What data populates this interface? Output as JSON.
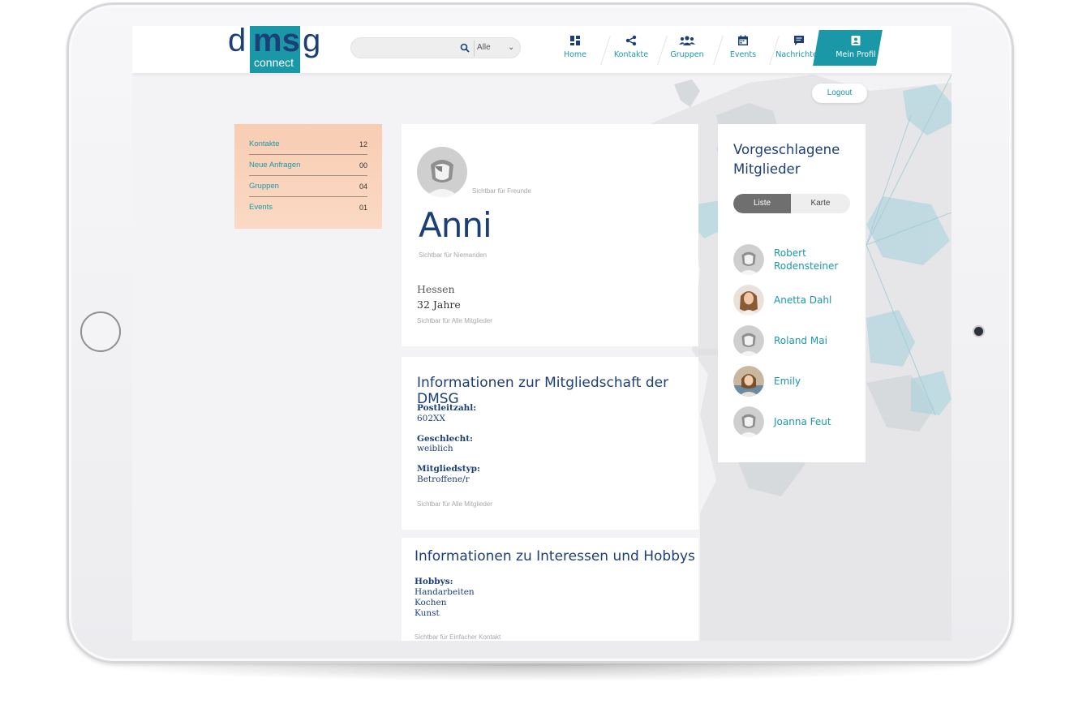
{
  "header": {
    "logo": {
      "d": "d",
      "ms": "ms",
      "g": "g",
      "sub": "connect"
    },
    "search": {
      "placeholder": "",
      "filter_value": "Alle"
    },
    "nav": [
      {
        "label": "Home",
        "icon": "home-grid-icon"
      },
      {
        "label": "Kontakte",
        "icon": "share-icon"
      },
      {
        "label": "Gruppen",
        "icon": "group-icon"
      },
      {
        "label": "Events",
        "icon": "calendar-icon"
      },
      {
        "label": "Nachrichten",
        "icon": "chat-icon"
      },
      {
        "label": "Mein Profil",
        "icon": "profile-card-icon",
        "active": true
      }
    ],
    "logout_label": "Logout"
  },
  "stats": [
    {
      "label": "Kontakte",
      "count": "12"
    },
    {
      "label": "Neue Anfragen",
      "count": "00"
    },
    {
      "label": "Gruppen",
      "count": "04"
    },
    {
      "label": "Events",
      "count": "01"
    }
  ],
  "profile": {
    "avatar_visibility": "Sichtbar für Freunde",
    "name": "Anni",
    "name_visibility": "Sichtbar für Niemanden",
    "region": "Hessen",
    "age": "32 Jahre",
    "details_visibility": "Sichtbar für Alle Mitglieder"
  },
  "membership": {
    "title": "Informationen zur Mitgliedschaft der DMSG",
    "fields": [
      {
        "label": "Postleitzahl:",
        "value": "602XX"
      },
      {
        "label": "Geschlecht:",
        "value": "weiblich"
      },
      {
        "label": "Mitgliedstyp:",
        "value": "Betroffene/r"
      }
    ],
    "visibility": "Sichtbar für Alle Mitglieder"
  },
  "interests": {
    "title": "Informationen zu Interessen und Hobbys",
    "hobbies_label": "Hobbys:",
    "hobbies": [
      "Handarbeiten",
      "Kochen",
      "Kunst"
    ],
    "visibility": "Sichtbar für Einfacher Kontakt"
  },
  "suggested": {
    "title": "Vorgeschlagene Mitglieder",
    "toggle": {
      "list": "Liste",
      "map": "Karte",
      "selected": "Liste"
    },
    "members": [
      {
        "name": "Robert Rodensteiner",
        "avatar": "placeholder"
      },
      {
        "name": "Anetta Dahl",
        "avatar": "photo"
      },
      {
        "name": "Roland Mai",
        "avatar": "placeholder"
      },
      {
        "name": "Emily",
        "avatar": "photo"
      },
      {
        "name": "Joanna Feut",
        "avatar": "placeholder"
      }
    ]
  },
  "colors": {
    "brand_teal": "#1a98a8",
    "brand_navy": "#1c3f77",
    "stats_peach": "#f8cdb3"
  }
}
